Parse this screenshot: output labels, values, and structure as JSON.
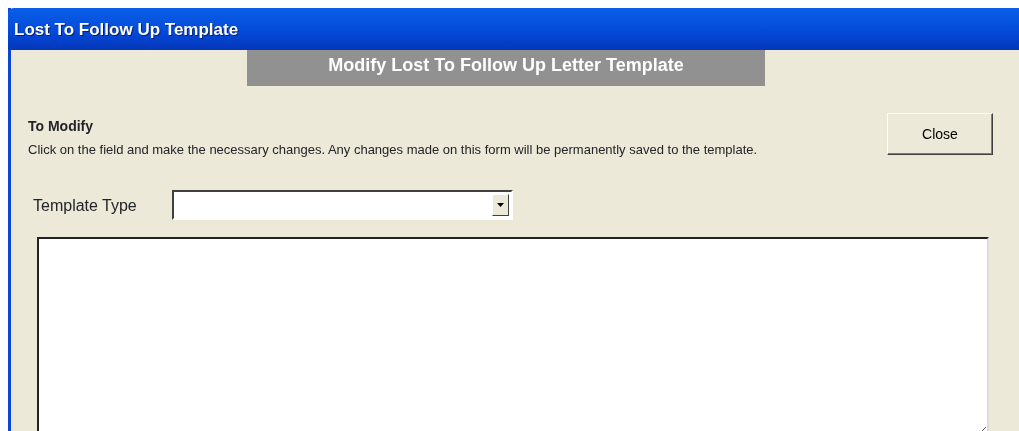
{
  "window": {
    "title": "Lost To Follow Up Template"
  },
  "banner": "Modify Lost To Follow Up Letter Template",
  "instructions": {
    "heading": "To Modify",
    "text": "Click on the field and make the necessary changes.  Any changes made on this form will be permanently saved to the template."
  },
  "close_button": "Close",
  "template_type": {
    "label": "Template Type"
  }
}
